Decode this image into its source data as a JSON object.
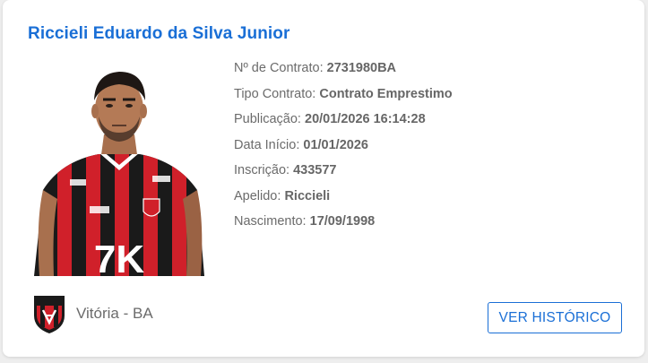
{
  "player": {
    "name": "Riccieli Eduardo da Silva Junior",
    "photo_alt": "Foto do jogador"
  },
  "details": [
    {
      "label": "Nº de Contrato:",
      "value": "2731980BA"
    },
    {
      "label": "Tipo Contrato:",
      "value": "Contrato Emprestimo"
    },
    {
      "label": "Publicação:",
      "value": "20/01/2026 16:14:28"
    },
    {
      "label": "Data Início:",
      "value": "01/01/2026"
    },
    {
      "label": "Inscrição:",
      "value": "433577"
    },
    {
      "label": "Apelido:",
      "value": "Riccieli"
    },
    {
      "label": "Nascimento:",
      "value": "17/09/1998"
    }
  ],
  "club": {
    "name": "Vitória - BA",
    "crest_icon": "club-crest-icon"
  },
  "actions": {
    "history_button": "VER HISTÓRICO"
  },
  "colors": {
    "accent": "#1a6fd6",
    "text_muted": "#6b6b6b",
    "kit_red": "#d0202a",
    "kit_black": "#1a1a1a"
  }
}
